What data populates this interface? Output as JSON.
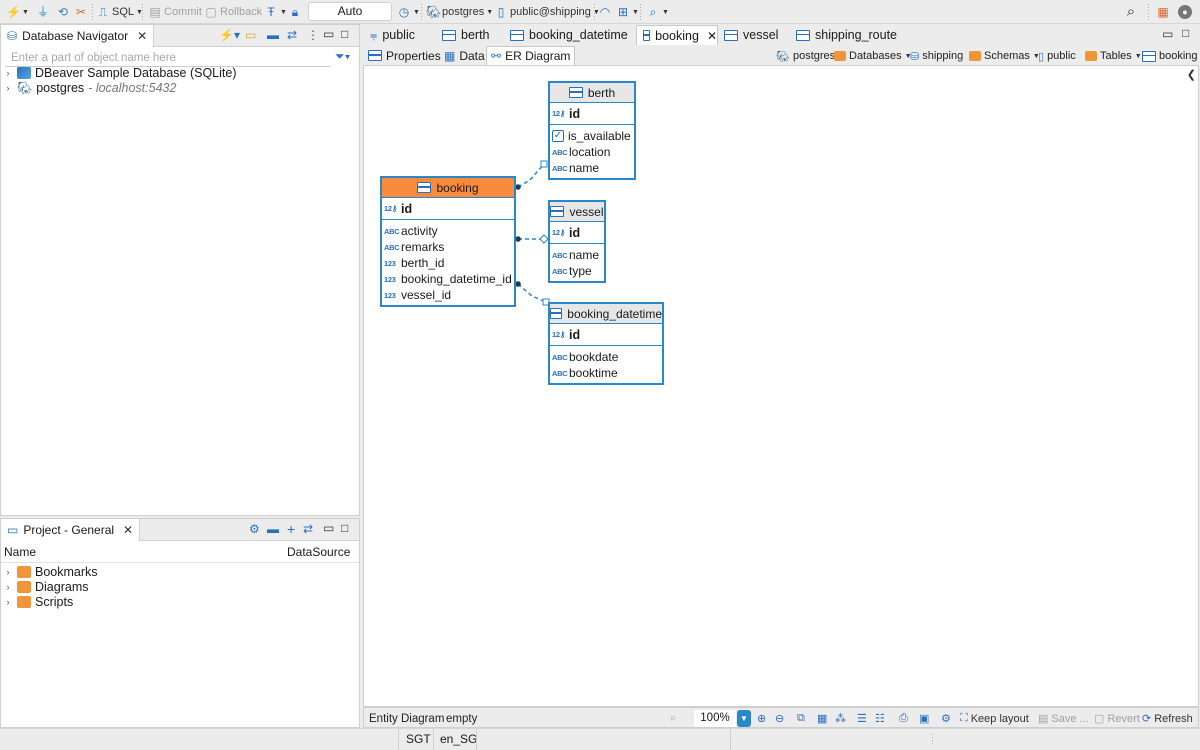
{
  "toolbar": {
    "sql_label": "SQL",
    "commit_label": "Commit",
    "rollback_label": "Rollback",
    "transaction_mode": "Auto",
    "connection": "postgres",
    "schema": "public@shipping"
  },
  "navigator": {
    "title": "Database Navigator",
    "search_placeholder": "Enter a part of object name here",
    "items": [
      {
        "label": "DBeaver Sample Database (SQLite)",
        "detail": ""
      },
      {
        "label": "postgres",
        "detail": "- localhost:5432"
      }
    ]
  },
  "project": {
    "title": "Project - General",
    "col_name": "Name",
    "col_datasource": "DataSource",
    "items": [
      {
        "label": "Bookmarks"
      },
      {
        "label": "Diagrams"
      },
      {
        "label": "Scripts"
      }
    ]
  },
  "editor_tabs": [
    "public",
    "berth",
    "booking_datetime",
    "booking",
    "vessel",
    "shipping_route"
  ],
  "sub_tabs": [
    "Properties",
    "Data",
    "ER Diagram"
  ],
  "breadcrumb": {
    "connection": "postgres",
    "databases": "Databases",
    "database": "shipping",
    "schemas": "Schemas",
    "schema": "public",
    "tables": "Tables",
    "table": "booking"
  },
  "diagram": {
    "booking": {
      "name": "booking",
      "key": "id",
      "columns": [
        {
          "type": "ABC",
          "name": "activity"
        },
        {
          "type": "ABC",
          "name": "remarks"
        },
        {
          "type": "123",
          "name": "berth_id"
        },
        {
          "type": "123",
          "name": "booking_datetime_id"
        },
        {
          "type": "123",
          "name": "vessel_id"
        }
      ]
    },
    "berth": {
      "name": "berth",
      "key": "id",
      "columns": [
        {
          "type": "chk",
          "name": "is_available"
        },
        {
          "type": "ABC",
          "name": "location"
        },
        {
          "type": "ABC",
          "name": "name"
        }
      ]
    },
    "vessel": {
      "name": "vessel",
      "key": "id",
      "columns": [
        {
          "type": "ABC",
          "name": "name"
        },
        {
          "type": "ABC",
          "name": "type"
        }
      ]
    },
    "booking_datetime": {
      "name": "booking_datetime",
      "key": "id",
      "columns": [
        {
          "type": "ABC",
          "name": "bookdate"
        },
        {
          "type": "ABC",
          "name": "booktime"
        }
      ]
    }
  },
  "status": {
    "label": "Entity Diagram",
    "state": "empty",
    "zoom": "100%",
    "keep_layout": "Keep layout",
    "save": "Save ...",
    "revert": "Revert",
    "refresh": "Refresh"
  },
  "bottom": {
    "timezone": "SGT",
    "locale": "en_SG"
  },
  "colors": {
    "accent": "#2a87c8",
    "selected_entity": "#f88a3d"
  }
}
